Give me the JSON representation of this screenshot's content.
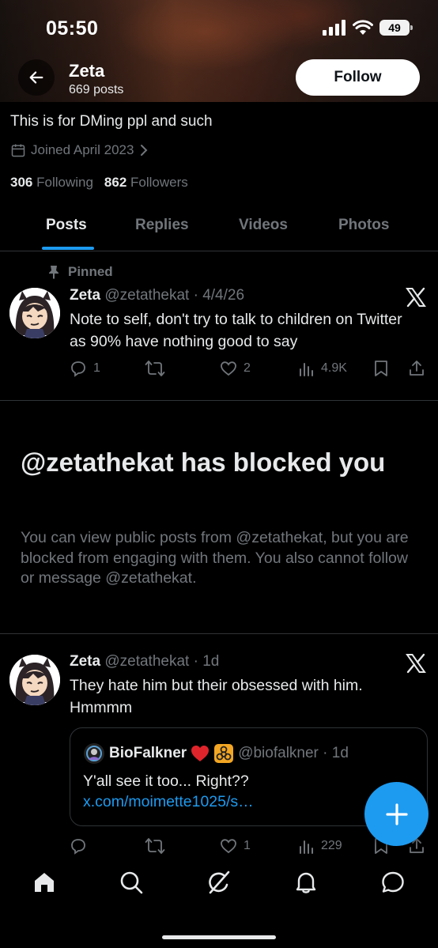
{
  "status_bar": {
    "time": "05:50",
    "battery": "49"
  },
  "profile": {
    "name": "Zeta",
    "post_count": "669 posts",
    "follow_label": "Follow",
    "bio": "This is for DMing ppl and such",
    "joined": "Joined April 2023",
    "following_count": "306",
    "following_label": "Following",
    "followers_count": "862",
    "followers_label": "Followers"
  },
  "tabs": [
    {
      "label": "Posts",
      "active": true
    },
    {
      "label": "Replies",
      "active": false
    },
    {
      "label": "Videos",
      "active": false
    },
    {
      "label": "Photos",
      "active": false
    }
  ],
  "pinned_tweet": {
    "pinned_label": "Pinned",
    "name": "Zeta",
    "handle_date": "@zetathekat · 4/4/26",
    "text": "Note to self, don't try to talk to children on Twitter as 90% have nothing good to say",
    "replies": "1",
    "retweets": "",
    "likes": "2",
    "views": "4.9K"
  },
  "blocked_notice": {
    "title": "@zetathekat has blocked you",
    "description": "You can view public posts from @zetathekat, but you are blocked from engaging with them. You also cannot follow or message @zetathekat."
  },
  "tweet": {
    "name": "Zeta",
    "handle_date": "@zetathekat · 1d",
    "text": "They hate him but their obsessed with him. Hmmmm",
    "quote": {
      "name": "BioFalkner",
      "handle_date": "@biofalkner · 1d",
      "text": "Y'all see it too... Right?? ",
      "link": "x.com/moimette1025/s…"
    },
    "replies": "",
    "retweets": "",
    "likes": "1",
    "views": "229"
  },
  "colors": {
    "accent": "#1d9bf0",
    "muted": "#71767b",
    "text": "#e7e9ea",
    "border": "#2f3336"
  },
  "icons": [
    "back-arrow-icon",
    "calendar-icon",
    "chevron-right-icon",
    "pin-icon",
    "x-logo-icon",
    "reply-icon",
    "retweet-icon",
    "like-icon",
    "views-icon",
    "bookmark-icon",
    "share-icon",
    "plus-icon",
    "home-icon",
    "search-icon",
    "grok-icon",
    "notifications-icon",
    "messages-icon"
  ]
}
